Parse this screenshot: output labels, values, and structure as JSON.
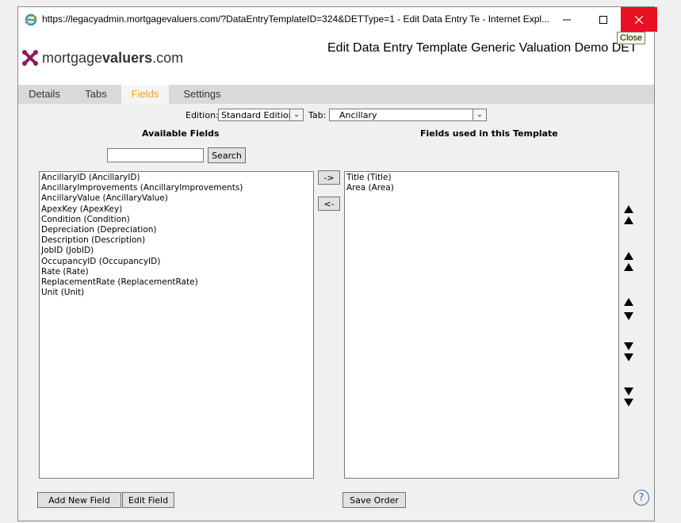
{
  "window": {
    "title": "https://legacyadmin.mortgagevaluers.com/?DataEntryTemplateID=324&DETType=1 - Edit Data Entry Te - Internet Expl...",
    "close_tooltip": "Close"
  },
  "header": {
    "logo_light": "mortgage",
    "logo_bold": "valuers",
    "logo_suffix": ".com",
    "page_title": "Edit Data Entry Template Generic Valuation Demo DET"
  },
  "tabs": [
    {
      "label": "Details"
    },
    {
      "label": "Tabs"
    },
    {
      "label": "Fields",
      "active": true
    },
    {
      "label": "Settings"
    }
  ],
  "filters": {
    "edition_label": "Edition:",
    "edition_value": "Standard Edition",
    "tab_label": "Tab:",
    "tab_value": "Ancillary"
  },
  "available": {
    "heading": "Available Fields",
    "search_value": "",
    "search_button": "Search",
    "items": [
      "AncillaryID (AncillaryID)",
      "AncillaryImprovements (AncillaryImprovements)",
      "AncillaryValue (AncillaryValue)",
      "ApexKey (ApexKey)",
      "Condition (Condition)",
      "Depreciation (Depreciation)",
      "Description (Description)",
      "JobID (JobID)",
      "OccupancyID (OccupancyID)",
      "Rate (Rate)",
      "ReplacementRate (ReplacementRate)",
      "Unit (Unit)"
    ]
  },
  "used": {
    "heading": "Fields used in this Template",
    "items": [
      "Title (Title)",
      "Area (Area)"
    ]
  },
  "move": {
    "add_label": "->",
    "remove_label": "<-"
  },
  "footer": {
    "add_new_field": "Add New Field",
    "edit_field": "Edit Field",
    "save_order": "Save Order",
    "help": "?"
  },
  "colors": {
    "active_tab": "#f0a030",
    "close_button": "#e81123",
    "logo_mark": "#8b1a5e"
  }
}
